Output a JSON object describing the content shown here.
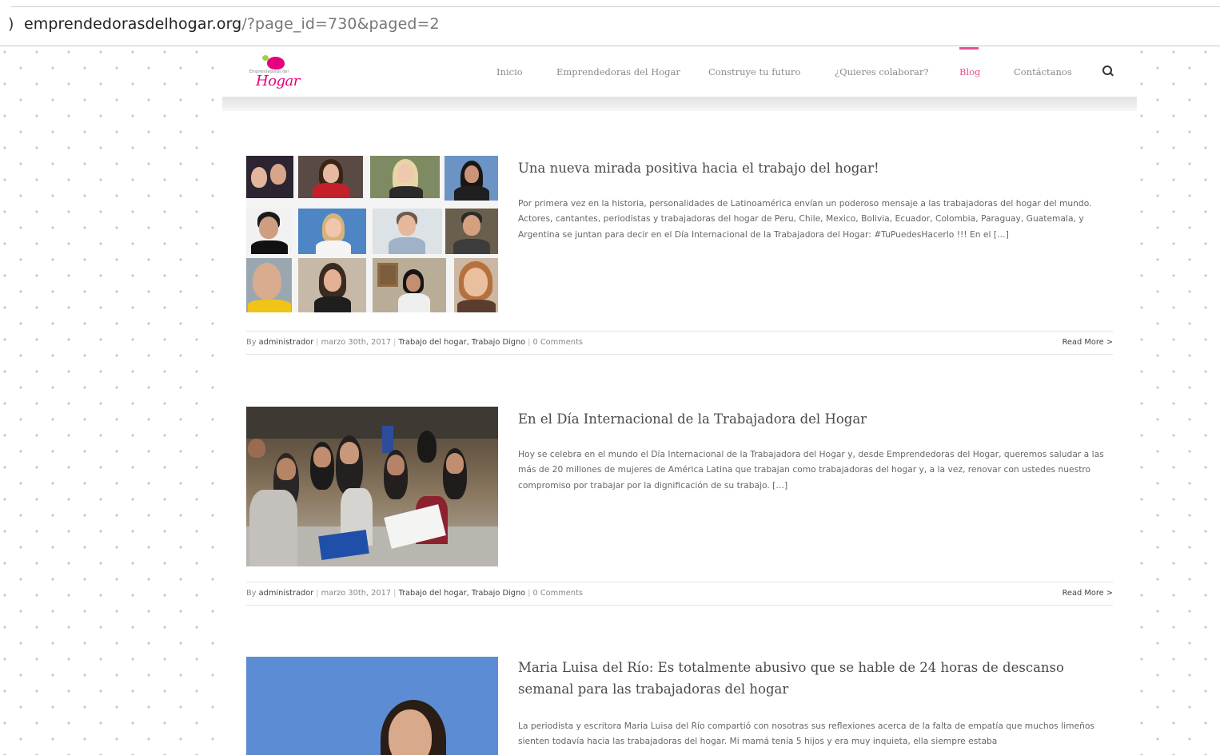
{
  "browser": {
    "chevron": ")",
    "url_host": "emprendedorasdelhogar.org",
    "url_path": "/?page_id=730&paged=2"
  },
  "site": {
    "logo_small_text": "Emprendedoras del",
    "logo_word": "Hogar",
    "brand_color": "#e6508f"
  },
  "nav": {
    "items": [
      {
        "label": "Inicio"
      },
      {
        "label": "Emprendedoras del Hogar"
      },
      {
        "label": "Construye tu futuro"
      },
      {
        "label": "¿Quieres colaborar?"
      },
      {
        "label": "Blog",
        "active": true
      },
      {
        "label": "Contáctanos"
      }
    ],
    "search_icon": "search-icon"
  },
  "posts": [
    {
      "title": "Una nueva mirada positiva hacia el trabajo del hogar!",
      "excerpt": "Por primera vez en la historia, personalidades de Latinoamérica envían un poderoso mensaje a las trabajadoras del hogar del mundo. Actores, cantantes, periodistas y trabajadoras del hogar de Peru, Chile, Mexico, Bolivia, Ecuador, Colombia, Paraguay, Guatemala, y Argentina se juntan para decir en el Día Internacional de la Trabajadora del Hogar: #TuPuedesHacerlo !!! En el […]",
      "meta": {
        "by": "By",
        "author": "administrador",
        "date": "marzo 30th, 2017",
        "categories": "Trabajo del hogar, Trabajo Digno",
        "comments": "0 Comments",
        "read_more": "Read More >"
      }
    },
    {
      "title": "En el Día Internacional de la Trabajadora del Hogar",
      "excerpt": "Hoy se celebra en el mundo el Día Internacional de la Trabajadora del Hogar y, desde Emprendedoras del Hogar, queremos saludar a las más de 20 millones de mujeres de América Latina que trabajan como trabajadoras del hogar y, a la vez, renovar con ustedes nuestro compromiso por trabajar por la dignificación de su trabajo. […]",
      "meta": {
        "by": "By",
        "author": "administrador",
        "date": "marzo 30th, 2017",
        "categories": "Trabajo del hogar, Trabajo Digno",
        "comments": "0 Comments",
        "read_more": "Read More >"
      }
    },
    {
      "title": "Maria Luisa del Río: Es totalmente abusivo que se hable de 24 horas de descanso semanal para las trabajadoras del hogar",
      "excerpt": "La periodista y escritora Maria Luisa del Río compartió con nosotras sus reflexiones acerca de la falta de empatía que muchos limeños sienten todavía hacia las trabajadoras del hogar. Mi mamá tenía 5 hijos y era muy inquieta, ella siempre estaba"
    }
  ]
}
